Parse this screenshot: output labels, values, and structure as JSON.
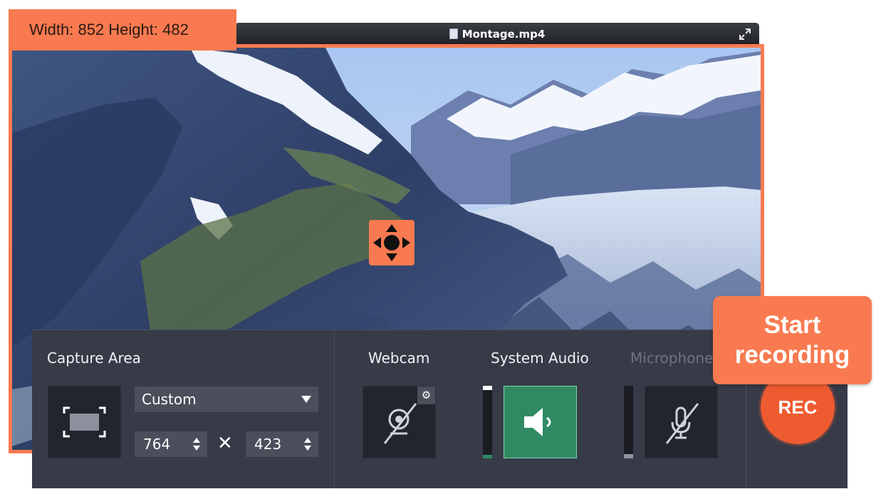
{
  "window": {
    "title": "Montage.mp4",
    "dimensions_label": "Width: 852 Height: 482"
  },
  "capture_area": {
    "label": "Capture Area",
    "preset": "Custom",
    "width_value": "764",
    "height_value": "423",
    "times_symbol": "✕"
  },
  "webcam": {
    "label": "Webcam",
    "state": "off"
  },
  "system_audio": {
    "label": "System Audio",
    "state": "on"
  },
  "microphone": {
    "label": "Microphone",
    "state": "off"
  },
  "record": {
    "button_label": "REC",
    "tooltip_line1": "Start",
    "tooltip_line2": "recording"
  },
  "colors": {
    "accent": "#f97a50",
    "panel": "#373b47",
    "active_green": "#2f8a64",
    "rec_red": "#ee5b30"
  },
  "icons": [
    "file-icon",
    "expand-icon",
    "move-icon",
    "capture-area-icon",
    "webcam-off-icon",
    "gear-icon",
    "speaker-icon",
    "microphone-off-icon",
    "spinner-arrows-icon",
    "dropdown-arrow-icon"
  ]
}
